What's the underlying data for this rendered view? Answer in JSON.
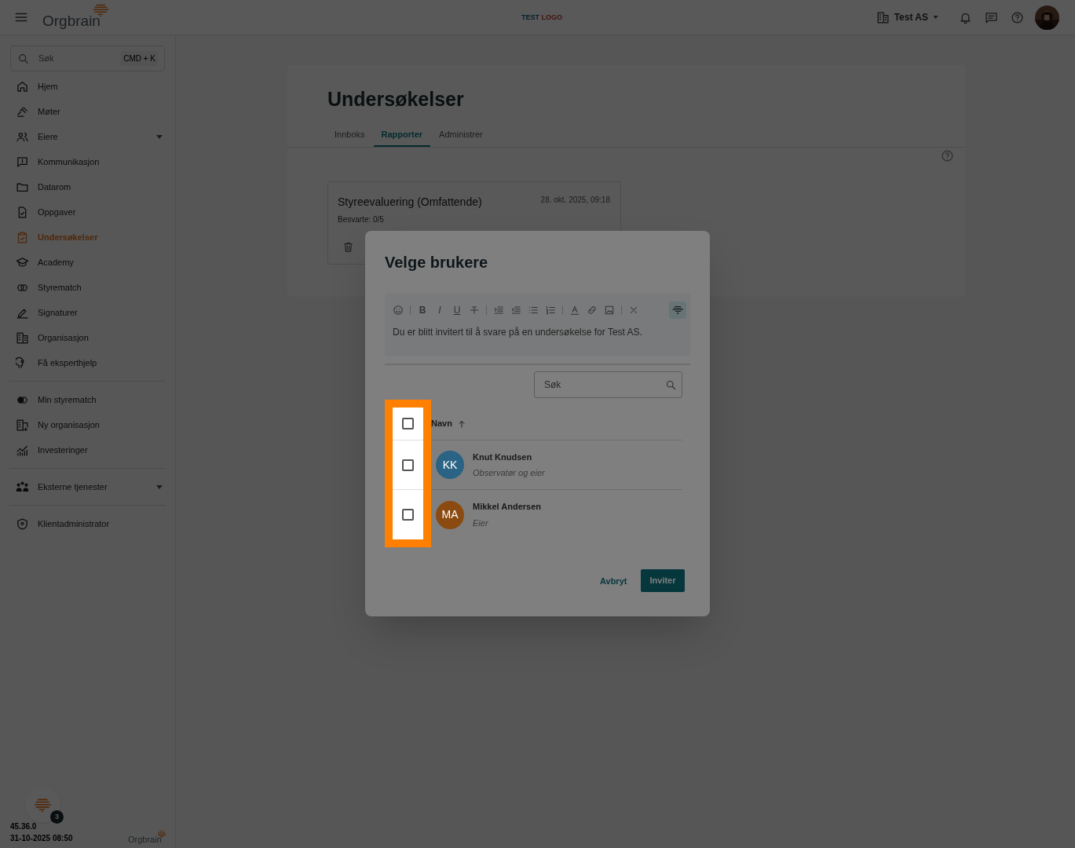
{
  "topbar": {
    "logo": "Orgbrain",
    "test_logo": [
      "TEST",
      "LOGO"
    ],
    "org": "Test AS"
  },
  "sidebar": {
    "search": {
      "placeholder": "Søk",
      "shortcut": "CMD + K"
    },
    "groups": [
      [
        {
          "label": "Hjem",
          "selected": false,
          "expandable": false
        },
        {
          "label": "Møter",
          "selected": false,
          "expandable": false
        },
        {
          "label": "Eiere",
          "selected": false,
          "expandable": true
        },
        {
          "label": "Kommunikasjon",
          "selected": false,
          "expandable": false
        },
        {
          "label": "Datarom",
          "selected": false,
          "expandable": false
        },
        {
          "label": "Oppgaver",
          "selected": false,
          "expandable": false
        },
        {
          "label": "Undersøkelser",
          "selected": true,
          "expandable": false
        },
        {
          "label": "Academy",
          "selected": false,
          "expandable": false
        },
        {
          "label": "Styrematch",
          "selected": false,
          "expandable": false
        },
        {
          "label": "Signaturer",
          "selected": false,
          "expandable": false
        },
        {
          "label": "Organisasjon",
          "selected": false,
          "expandable": false
        },
        {
          "label": "Få eksperthjelp",
          "selected": false,
          "expandable": false
        }
      ],
      [
        {
          "label": "Min styrematch",
          "selected": false,
          "expandable": false
        },
        {
          "label": "Ny organisasjon",
          "selected": false,
          "expandable": false
        },
        {
          "label": "Investeringer",
          "selected": false,
          "expandable": false
        }
      ],
      [
        {
          "label": "Eksterne tjenester",
          "selected": false,
          "expandable": true
        }
      ],
      [
        {
          "label": "Klientadministrator",
          "selected": false,
          "expandable": false
        }
      ]
    ],
    "badge": "3",
    "version": "45.36.0",
    "timestamp": "31-10-2025 08:50",
    "footer_logo": "Orgbrain"
  },
  "page": {
    "title": "Undersøkelser",
    "tabs": [
      {
        "label": "Innboks",
        "selected": false
      },
      {
        "label": "Rapporter",
        "selected": true
      },
      {
        "label": "Administrer",
        "selected": false
      }
    ],
    "survey": {
      "title": "Styreevaluering (Omfattende)",
      "date": "28. okt. 2025, 09:18",
      "answered": "Besvarte: 0/5"
    }
  },
  "dialog": {
    "title": "Velge brukere",
    "format_buttons": [
      "B",
      "I",
      "U"
    ],
    "message": "Du er blitt invitert til å svare på en undersøkelse for Test AS.",
    "search": {
      "placeholder": "Søk"
    },
    "column": "Navn",
    "select_all": {
      "checked": false
    },
    "users": [
      {
        "initials": "KK",
        "name": "Knut Knudsen",
        "role": "Observatør og eier",
        "color": "#2a6384",
        "checked": false
      },
      {
        "initials": "MA",
        "name": "Mikkel Andersen",
        "role": "Eier",
        "color": "#8a4a10",
        "checked": false
      }
    ],
    "buttons": {
      "cancel": "Avbryt",
      "confirm": "Inviter"
    }
  }
}
